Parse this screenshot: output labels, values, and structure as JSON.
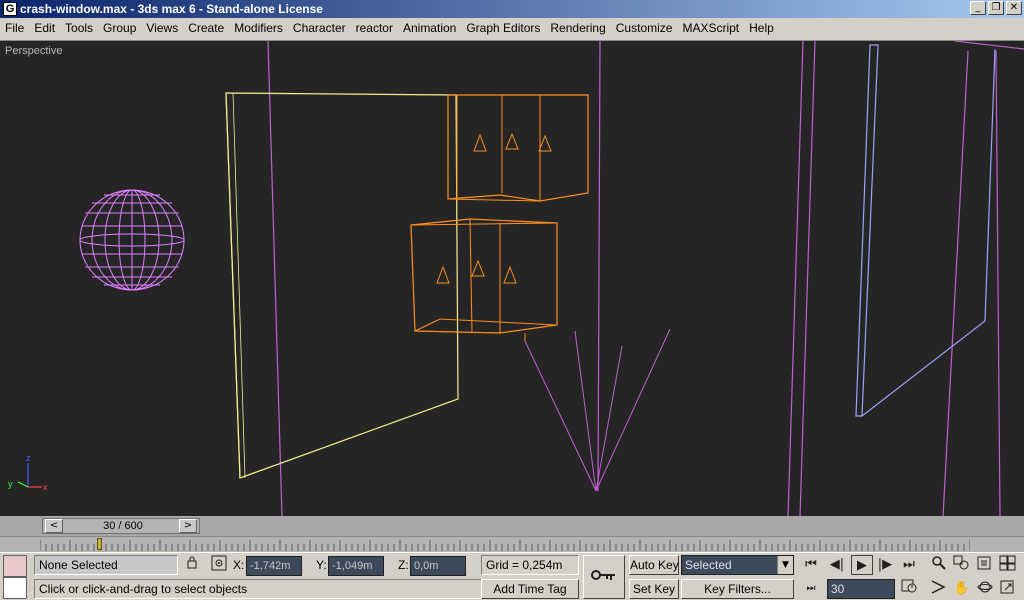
{
  "window": {
    "title": "crash-window.max - 3ds max 6 - Stand-alone License",
    "app_icon_glyph": "G",
    "minimize_glyph": "_",
    "restore_glyph": "❐",
    "close_glyph": "✕"
  },
  "menu": {
    "items": [
      "File",
      "Edit",
      "Tools",
      "Group",
      "Views",
      "Create",
      "Modifiers",
      "Character",
      "reactor",
      "Animation",
      "Graph Editors",
      "Rendering",
      "Customize",
      "MAXScript",
      "Help"
    ]
  },
  "viewport": {
    "label": "Perspective",
    "axis_labels": {
      "x": "x",
      "y": "y",
      "z": "z"
    },
    "colors": {
      "background": "#252525",
      "sphere": "#e080ff",
      "plane": "#f0f090",
      "cabinet": "#ff9020",
      "light": "#c060d0",
      "door": "#a0a0ff"
    }
  },
  "time_slider": {
    "label": "30 / 600",
    "prev_glyph": "<",
    "next_glyph": ">",
    "current_frame": 30,
    "total_frames": 600
  },
  "status": {
    "selection": "None Selected",
    "prompt": "Click or click-and-drag to select objects",
    "x_label": "X:",
    "x_value": "-1,742m",
    "y_label": "Y:",
    "y_value": "-1,049m",
    "z_label": "Z:",
    "z_value": "0,0m",
    "grid": "Grid = 0,254m",
    "add_time_tag": "Add Time Tag"
  },
  "animation": {
    "auto_key": "Auto Key",
    "set_key": "Set Key",
    "key_mode_selected": "Selected",
    "key_filters": "Key Filters...",
    "frame_value": "30"
  },
  "icons": {
    "lock": "lock-icon",
    "transform_mode": "absolute-mode-icon",
    "key": "key-icon",
    "goto_start": "⏮",
    "prev_frame": "◀|",
    "play": "▶",
    "next_frame": "|▶",
    "goto_end": "⏭"
  }
}
